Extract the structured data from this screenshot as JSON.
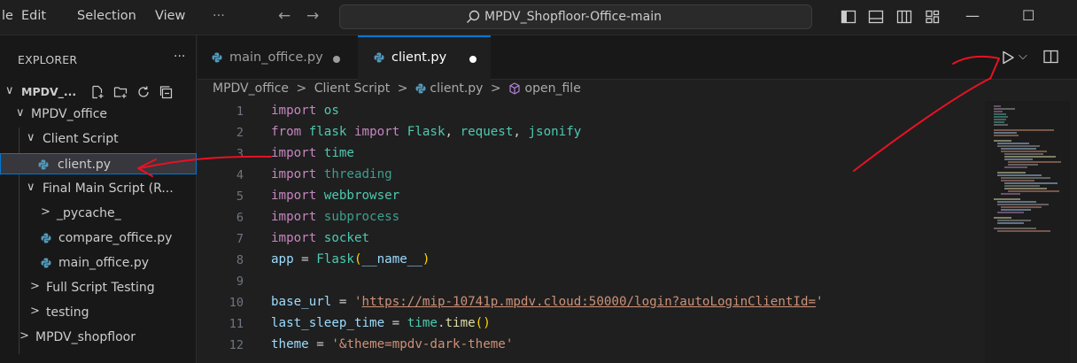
{
  "titlebar": {
    "menu": [
      "le",
      "Edit",
      "Selection",
      "View",
      "···"
    ],
    "back_arrow": "←",
    "forward_arrow": "→",
    "search_text": "MPDV_Shopfloor-Office-main",
    "minimize": "—",
    "maximize": "☐",
    "icons": [
      "toggle-primary-sidebar-icon",
      "toggle-panel-icon",
      "toggle-secondary-sidebar-icon",
      "customize-layout-icon"
    ]
  },
  "sidebar": {
    "title": "EXPLORER",
    "more": "···",
    "root": "MPDV_...",
    "root_actions": [
      "new-file-icon",
      "new-folder-icon",
      "refresh-icon",
      "collapse-all-icon"
    ],
    "tree": [
      {
        "label": "MPDV_office",
        "chevron": "∨"
      },
      {
        "label": "Client Script",
        "chevron": "∨"
      },
      {
        "label": "client.py",
        "selected": true
      },
      {
        "label": "Final Main Script (R...",
        "chevron": "∨"
      },
      {
        "label": "_pycache_",
        "chevron": ">"
      },
      {
        "label": "compare_office.py"
      },
      {
        "label": "main_office.py"
      },
      {
        "label": "Full Script Testing",
        "chevron": ">"
      },
      {
        "label": "testing",
        "chevron": ">"
      },
      {
        "label": "MPDV_shopfloor",
        "chevron": ">"
      }
    ]
  },
  "tabs": [
    {
      "label": "main_office.py",
      "active": false
    },
    {
      "label": "client.py",
      "active": true
    }
  ],
  "breadcrumb": [
    "MPDV_office",
    "Client Script",
    "client.py",
    "open_file"
  ],
  "breadcrumb_sep": ">",
  "code": {
    "line_numbers": [
      "1",
      "2",
      "3",
      "4",
      "5",
      "6",
      "7",
      "8",
      "9",
      "10",
      "11",
      "12"
    ],
    "lines": [
      "import os",
      "from flask import Flask, request, jsonify",
      "import time",
      "import threading",
      "import webbrowser",
      "import subprocess",
      "import socket",
      "app = Flask(__name__)",
      "",
      "base_url = 'https://mip-10741p.mpdv.cloud:50000/login?autoLoginClientId='",
      "last_sleep_time = time.time()",
      "theme = '&theme=mpdv-dark-theme'"
    ]
  },
  "colors": {
    "accent": "#0078d4",
    "keyword": "#c586c0",
    "module": "#4ec9b0",
    "string": "#ce9178",
    "annotation": "#e81123",
    "python_icon": "#519aba"
  }
}
